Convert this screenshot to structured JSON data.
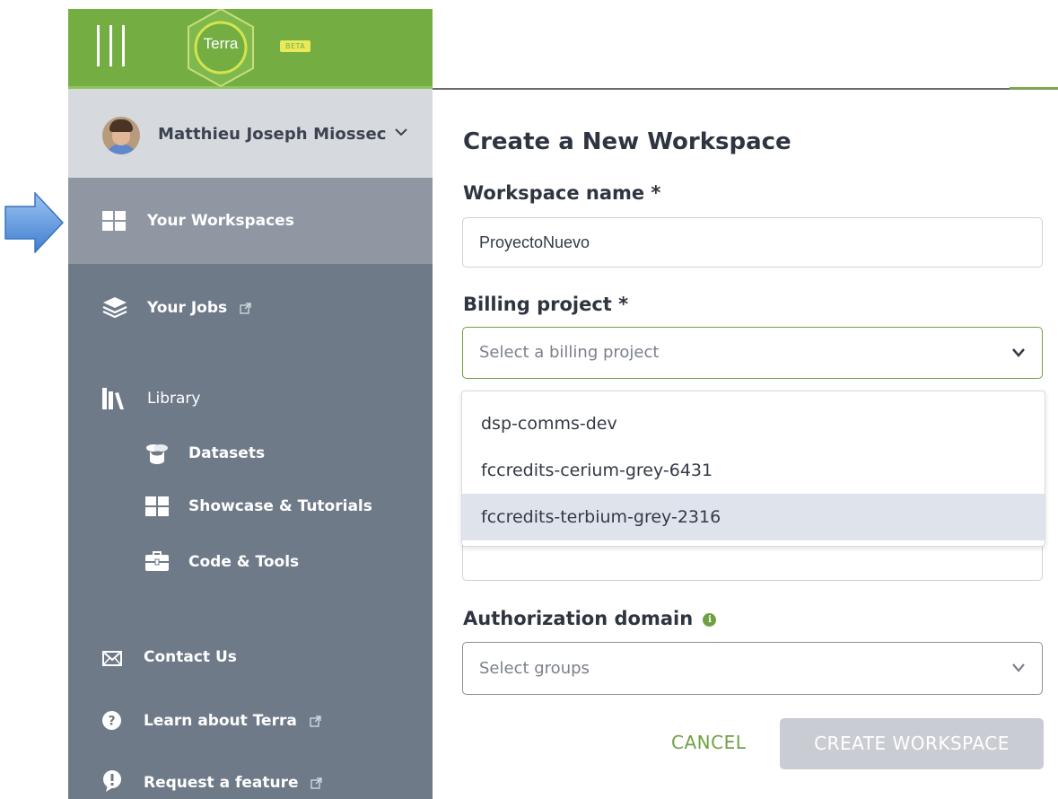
{
  "app": {
    "logo_text": "Terra",
    "beta_badge": "BETA"
  },
  "user": {
    "name": "Matthieu Joseph Miossec"
  },
  "sidebar": {
    "items": [
      {
        "label": "Your Workspaces",
        "icon": "grid-icon",
        "selected": true
      },
      {
        "label": "Your Jobs",
        "icon": "layers-icon",
        "external": true
      },
      {
        "label": "Library",
        "icon": "library-books-icon"
      },
      {
        "label": "Datasets",
        "icon": "database-icon",
        "sub": true
      },
      {
        "label": "Showcase & Tutorials",
        "icon": "grid-icon",
        "sub": true
      },
      {
        "label": "Code & Tools",
        "icon": "toolbox-icon",
        "sub": true
      },
      {
        "label": "Contact Us",
        "icon": "envelope-icon"
      },
      {
        "label": "Learn about Terra",
        "icon": "question-circle-icon",
        "external": true
      },
      {
        "label": "Request a feature",
        "icon": "exclamation-bubble-icon",
        "external": true
      }
    ]
  },
  "modal": {
    "title": "Create a New Workspace",
    "workspace_name_label": "Workspace name *",
    "workspace_name_value": "ProyectoNuevo",
    "billing_label": "Billing project *",
    "billing_placeholder": "Select a billing project",
    "billing_options": [
      "dsp-comms-dev",
      "fccredits-cerium-grey-6431",
      "fccredits-terbium-grey-2316"
    ],
    "billing_highlighted_index": 2,
    "auth_domain_label": "Authorization domain",
    "auth_domain_placeholder": "Select groups",
    "cancel_label": "CANCEL",
    "create_label": "CREATE WORKSPACE"
  },
  "colors": {
    "brand_green": "#74ae43",
    "sidebar_bg": "#6f7a89",
    "selected_nav_bg": "#8f97a3",
    "user_row_bg": "#d6d9de",
    "pointer_arrow": "#4f8fd8",
    "disabled_button": "#c9ccd2"
  }
}
